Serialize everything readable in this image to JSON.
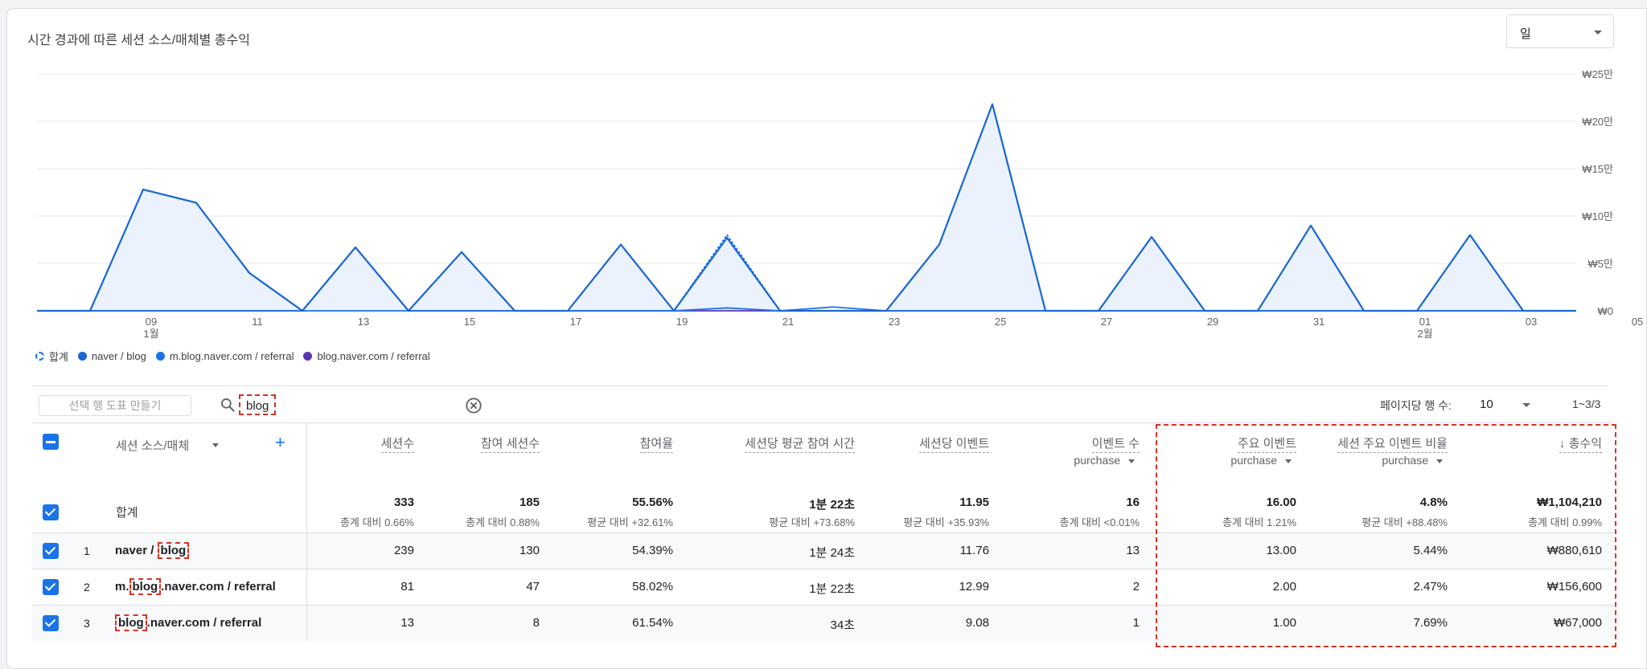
{
  "card": {
    "title": "시간 경과에 따른 세션 소스/매체별 총수익",
    "granularity": "일"
  },
  "chart_data": {
    "type": "area",
    "y_axis_labels": [
      "₩25만",
      "₩20만",
      "₩15만",
      "₩10만",
      "₩5만",
      "₩0"
    ],
    "ylim": [
      0,
      250000
    ],
    "x_tick_labels": [
      {
        "day": "09",
        "month": "1월"
      },
      {
        "day": "11",
        "month": ""
      },
      {
        "day": "13",
        "month": ""
      },
      {
        "day": "15",
        "month": ""
      },
      {
        "day": "17",
        "month": ""
      },
      {
        "day": "19",
        "month": ""
      },
      {
        "day": "21",
        "month": ""
      },
      {
        "day": "23",
        "month": ""
      },
      {
        "day": "25",
        "month": ""
      },
      {
        "day": "27",
        "month": ""
      },
      {
        "day": "29",
        "month": ""
      },
      {
        "day": "31",
        "month": ""
      },
      {
        "day": "01",
        "month": "2월"
      },
      {
        "day": "03",
        "month": ""
      },
      {
        "day": "05",
        "month": ""
      }
    ],
    "x": [
      "01-08",
      "01-09",
      "01-10",
      "01-11",
      "01-12",
      "01-13",
      "01-14",
      "01-15",
      "01-16",
      "01-17",
      "01-18",
      "01-19",
      "01-20",
      "01-21",
      "01-22",
      "01-23",
      "01-24",
      "01-25",
      "01-26",
      "01-27",
      "01-28",
      "01-29",
      "01-30",
      "01-31",
      "02-01",
      "02-02",
      "02-03",
      "02-04",
      "02-05",
      "02-06"
    ],
    "series": [
      {
        "name": "합계",
        "color": "#1a73e8",
        "style": "dashed",
        "values": [
          0,
          0,
          128000,
          114000,
          40000,
          0,
          67000,
          0,
          62000,
          0,
          0,
          70000,
          0,
          80000,
          0,
          0,
          0,
          70000,
          218000,
          0,
          0,
          78000,
          0,
          0,
          90000,
          0,
          0,
          80000,
          0,
          0
        ]
      },
      {
        "name": "naver / blog",
        "color": "#1967d2",
        "style": "solid",
        "values": [
          0,
          0,
          128000,
          114000,
          40000,
          0,
          67000,
          0,
          62000,
          0,
          0,
          70000,
          0,
          77000,
          0,
          0,
          0,
          70000,
          218000,
          0,
          0,
          78000,
          0,
          0,
          90000,
          0,
          0,
          80000,
          0,
          0
        ]
      },
      {
        "name": "m.blog.naver.com / referral",
        "color": "#1a73e8",
        "style": "solid",
        "values": [
          0,
          0,
          0,
          0,
          0,
          0,
          0,
          0,
          0,
          0,
          0,
          0,
          0,
          3000,
          0,
          4000,
          0,
          0,
          0,
          0,
          0,
          0,
          0,
          0,
          0,
          0,
          0,
          0,
          0,
          0
        ]
      },
      {
        "name": "blog.naver.com / referral",
        "color": "#5e35b1",
        "style": "solid",
        "values": [
          0,
          0,
          0,
          0,
          0,
          0,
          67000,
          0,
          0,
          0,
          0,
          0,
          0,
          0,
          0,
          0,
          0,
          0,
          0,
          0,
          0,
          0,
          0,
          0,
          0,
          0,
          0,
          0,
          0,
          0
        ]
      }
    ]
  },
  "legend": [
    {
      "label": "합계",
      "color": "#1a73e8",
      "dashed": true
    },
    {
      "label": "naver / blog",
      "color": "#1967d2",
      "dashed": false
    },
    {
      "label": "m.blog.naver.com / referral",
      "color": "#1a73e8",
      "dashed": false
    },
    {
      "label": "blog.naver.com / referral",
      "color": "#5e35b1",
      "dashed": false
    }
  ],
  "toolbar": {
    "plot_rows_label": "선택 행 도표 만들기",
    "search_value": "blog",
    "rows_per_page_label": "페이지당 행 수:",
    "rows_per_page_value": "10",
    "pager": "1~3/3"
  },
  "table": {
    "dimension_header": "세션 소스/매체",
    "columns": [
      {
        "label": "세션수",
        "sub": ""
      },
      {
        "label": "참여 세션수",
        "sub": ""
      },
      {
        "label": "참여율",
        "sub": ""
      },
      {
        "label": "세션당 평균 참여 시간",
        "sub": ""
      },
      {
        "label": "세션당 이벤트",
        "sub": ""
      },
      {
        "label": "이벤트 수",
        "sub": "purchase"
      },
      {
        "label": "주요 이벤트",
        "sub": "purchase"
      },
      {
        "label": "세션 주요 이벤트 비율",
        "sub": "purchase"
      },
      {
        "label": "↓ 총수익",
        "sub": ""
      }
    ],
    "totals": {
      "label": "합계",
      "values": [
        "333",
        "185",
        "55.56%",
        "1분 22초",
        "11.95",
        "16",
        "16.00",
        "4.8%",
        "₩1,104,210"
      ],
      "subs": [
        "총계 대비 0.66%",
        "총계 대비 0.88%",
        "평균 대비 +32.61%",
        "평균 대비 +73.68%",
        "평균 대비 +35.93%",
        "총계 대비 <0.01%",
        "총계 대비 1.21%",
        "평균 대비 +88.48%",
        "총계 대비 0.99%"
      ]
    },
    "rows": [
      {
        "num": "1",
        "pre": "naver / ",
        "hl": "blog",
        "post": "",
        "values": [
          "239",
          "130",
          "54.39%",
          "1분 24초",
          "11.76",
          "13",
          "13.00",
          "5.44%",
          "₩880,610"
        ]
      },
      {
        "num": "2",
        "pre": "m.",
        "hl": "blog",
        "post": ".naver.com / referral",
        "values": [
          "81",
          "47",
          "58.02%",
          "1분 22초",
          "12.99",
          "2",
          "2.00",
          "2.47%",
          "₩156,600"
        ]
      },
      {
        "num": "3",
        "pre": "",
        "hl": "blog",
        "post": ".naver.com / referral",
        "values": [
          "13",
          "8",
          "61.54%",
          "34초",
          "9.08",
          "1",
          "1.00",
          "7.69%",
          "₩67,000"
        ]
      }
    ]
  }
}
